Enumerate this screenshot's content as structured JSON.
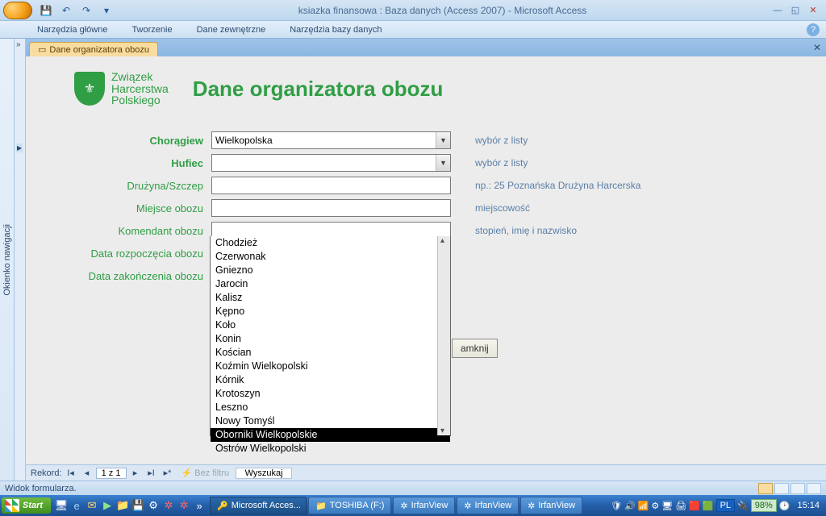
{
  "titlebar": {
    "title": "ksiazka finansowa : Baza danych (Access 2007) - Microsoft Access"
  },
  "ribbon": {
    "tabs": [
      "Narzędzia główne",
      "Tworzenie",
      "Dane zewnętrzne",
      "Narzędzia bazy danych"
    ]
  },
  "nav_pane_label": "Okienko nawigacji",
  "doc_tab": {
    "label": "Dane organizatora obozu"
  },
  "logo": {
    "line1": "Związek",
    "line2": "Harcerstwa",
    "line3": "Polskiego"
  },
  "form_title": "Dane organizatora obozu",
  "fields": {
    "choragiew": {
      "label": "Chorągiew",
      "value": "Wielkopolska",
      "hint": "wybór z listy"
    },
    "hufiec": {
      "label": "Hufiec",
      "value": "",
      "hint": "wybór z listy"
    },
    "druzyna": {
      "label": "Drużyna/Szczep",
      "hint": "np.: 25 Poznańska Drużyna Harcerska"
    },
    "miejsce": {
      "label": "Miejsce obozu",
      "hint": "miejscowość"
    },
    "komendant": {
      "label": "Komendant obozu",
      "hint": "stopień, imię i nazwisko"
    },
    "data_start": {
      "label": "Data rozpoczęcia obozu"
    },
    "data_end": {
      "label": "Data zakończenia obozu"
    }
  },
  "hufiec_options": [
    "Chodzież",
    "Czerwonak",
    "Gniezno",
    "Jarocin",
    "Kalisz",
    "Kępno",
    "Koło",
    "Konin",
    "Kościan",
    "Koźmin Wielkopolski",
    "Kórnik",
    "Krotoszyn",
    "Leszno",
    "Nowy Tomyśl",
    "Oborniki Wielkopolskie",
    "Ostrów Wielkopolski"
  ],
  "hufiec_selected_index": 14,
  "close_button_visible_part": "amknij",
  "recnav": {
    "label": "Rekord:",
    "pos": "1 z 1",
    "nofilter": "Bez filtru",
    "search": "Wyszukaj"
  },
  "statusbar": {
    "text": "Widok formularza."
  },
  "taskbar": {
    "start": "Start",
    "tasks": [
      {
        "label": "Microsoft Acces...",
        "icon": "🔑",
        "active": true
      },
      {
        "label": "TOSHIBA (F:)",
        "icon": "📁",
        "active": false
      },
      {
        "label": "IrfanView",
        "icon": "✲",
        "active": false
      },
      {
        "label": "IrfanView",
        "icon": "✲",
        "active": false
      },
      {
        "label": "IrfanView",
        "icon": "✲",
        "active": false
      }
    ],
    "lang": "PL",
    "battery": "98%",
    "clock": "15:14"
  }
}
